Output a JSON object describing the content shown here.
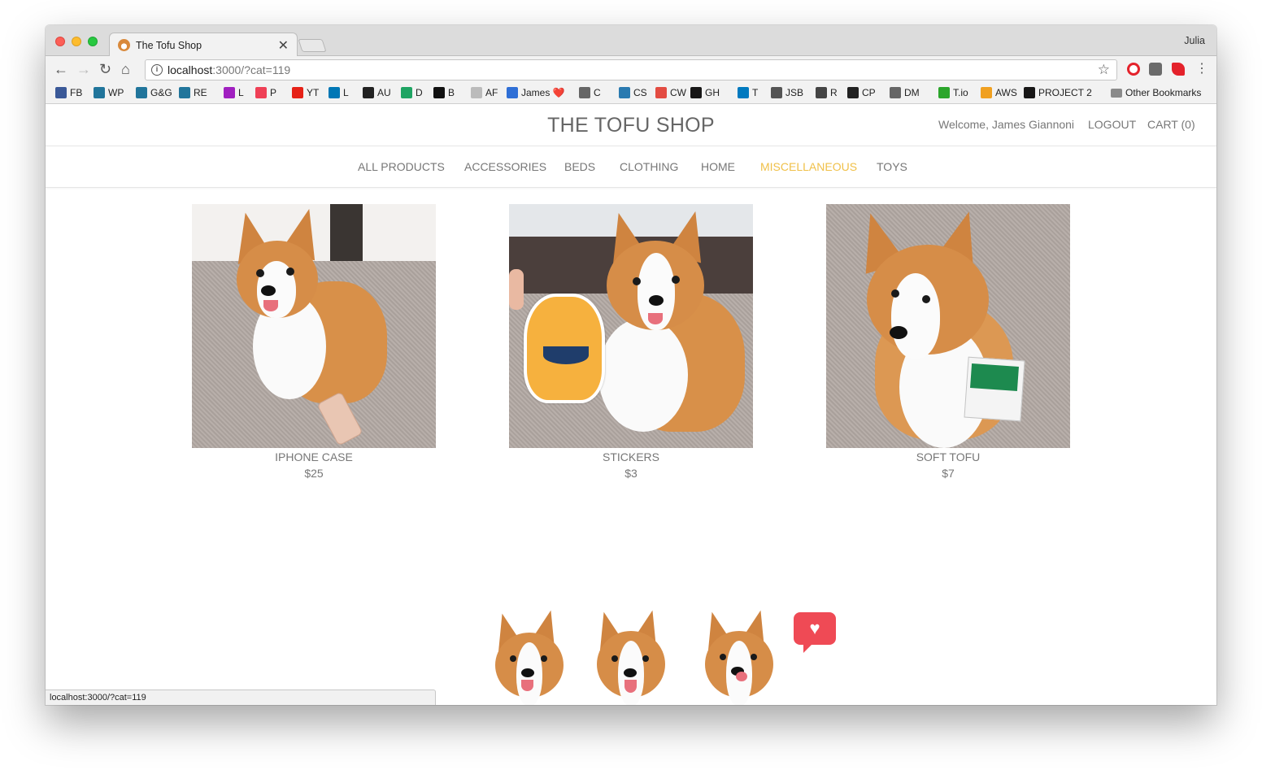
{
  "browser": {
    "tab_title": "The Tofu Shop",
    "profile_name": "Julia",
    "url_host": "localhost",
    "url_rest": ":3000/?cat=119",
    "status_url": "localhost:3000/?cat=119"
  },
  "bookmarks": [
    {
      "label": "FB",
      "color": "#3b5998"
    },
    {
      "label": "WP",
      "color": "#21759b"
    },
    {
      "label": "G&G",
      "color": "#21759b"
    },
    {
      "label": "RE",
      "color": "#21759b"
    },
    {
      "label": "L",
      "color": "#a020c0"
    },
    {
      "label": "P",
      "color": "#ef4056"
    },
    {
      "label": "YT",
      "color": "#e62117"
    },
    {
      "label": "L",
      "color": "#0077b5"
    },
    {
      "label": "AU",
      "color": "#222222"
    },
    {
      "label": "D",
      "color": "#1fa463"
    },
    {
      "label": "B",
      "color": "#111111"
    },
    {
      "label": "AF",
      "color": "#bbbbbb"
    },
    {
      "label": "James ❤️",
      "color": "#2f6fd6"
    },
    {
      "label": "C",
      "color": "#666666"
    },
    {
      "label": "CS",
      "color": "#2a7ab0"
    },
    {
      "label": "CW",
      "color": "#e34c42"
    },
    {
      "label": "GH",
      "color": "#181717"
    },
    {
      "label": "T",
      "color": "#0079bf"
    },
    {
      "label": "JSB",
      "color": "#555555"
    },
    {
      "label": "R",
      "color": "#444444"
    },
    {
      "label": "CP",
      "color": "#222222"
    },
    {
      "label": "DM",
      "color": "#666666"
    },
    {
      "label": "T.io",
      "color": "#2ba52b"
    },
    {
      "label": "AWS",
      "color": "#f0a020"
    },
    {
      "label": "PROJECT 2",
      "color": "#181717"
    }
  ],
  "other_bookmarks": "Other Bookmarks",
  "site": {
    "title": "THE TOFU SHOP",
    "welcome": "Welcome, James Giannoni",
    "logout": "LOGOUT",
    "cart": "CART (0)"
  },
  "categories": [
    {
      "label": "ALL PRODUCTS",
      "active": false
    },
    {
      "label": "ACCESSORIES",
      "active": false
    },
    {
      "label": "BEDS",
      "active": false
    },
    {
      "label": "CLOTHING",
      "active": false
    },
    {
      "label": "HOME",
      "active": false
    },
    {
      "label": "MISCELLANEOUS",
      "active": true
    },
    {
      "label": "TOYS",
      "active": false
    }
  ],
  "products": [
    {
      "name": "IPHONE CASE",
      "price": "$25"
    },
    {
      "name": "STICKERS",
      "price": "$3"
    },
    {
      "name": "SOFT TOFU",
      "price": "$7"
    }
  ],
  "colors": {
    "accent_active": "#f0c048",
    "heart": "#ef4a55",
    "corgi": "#d68d48"
  }
}
